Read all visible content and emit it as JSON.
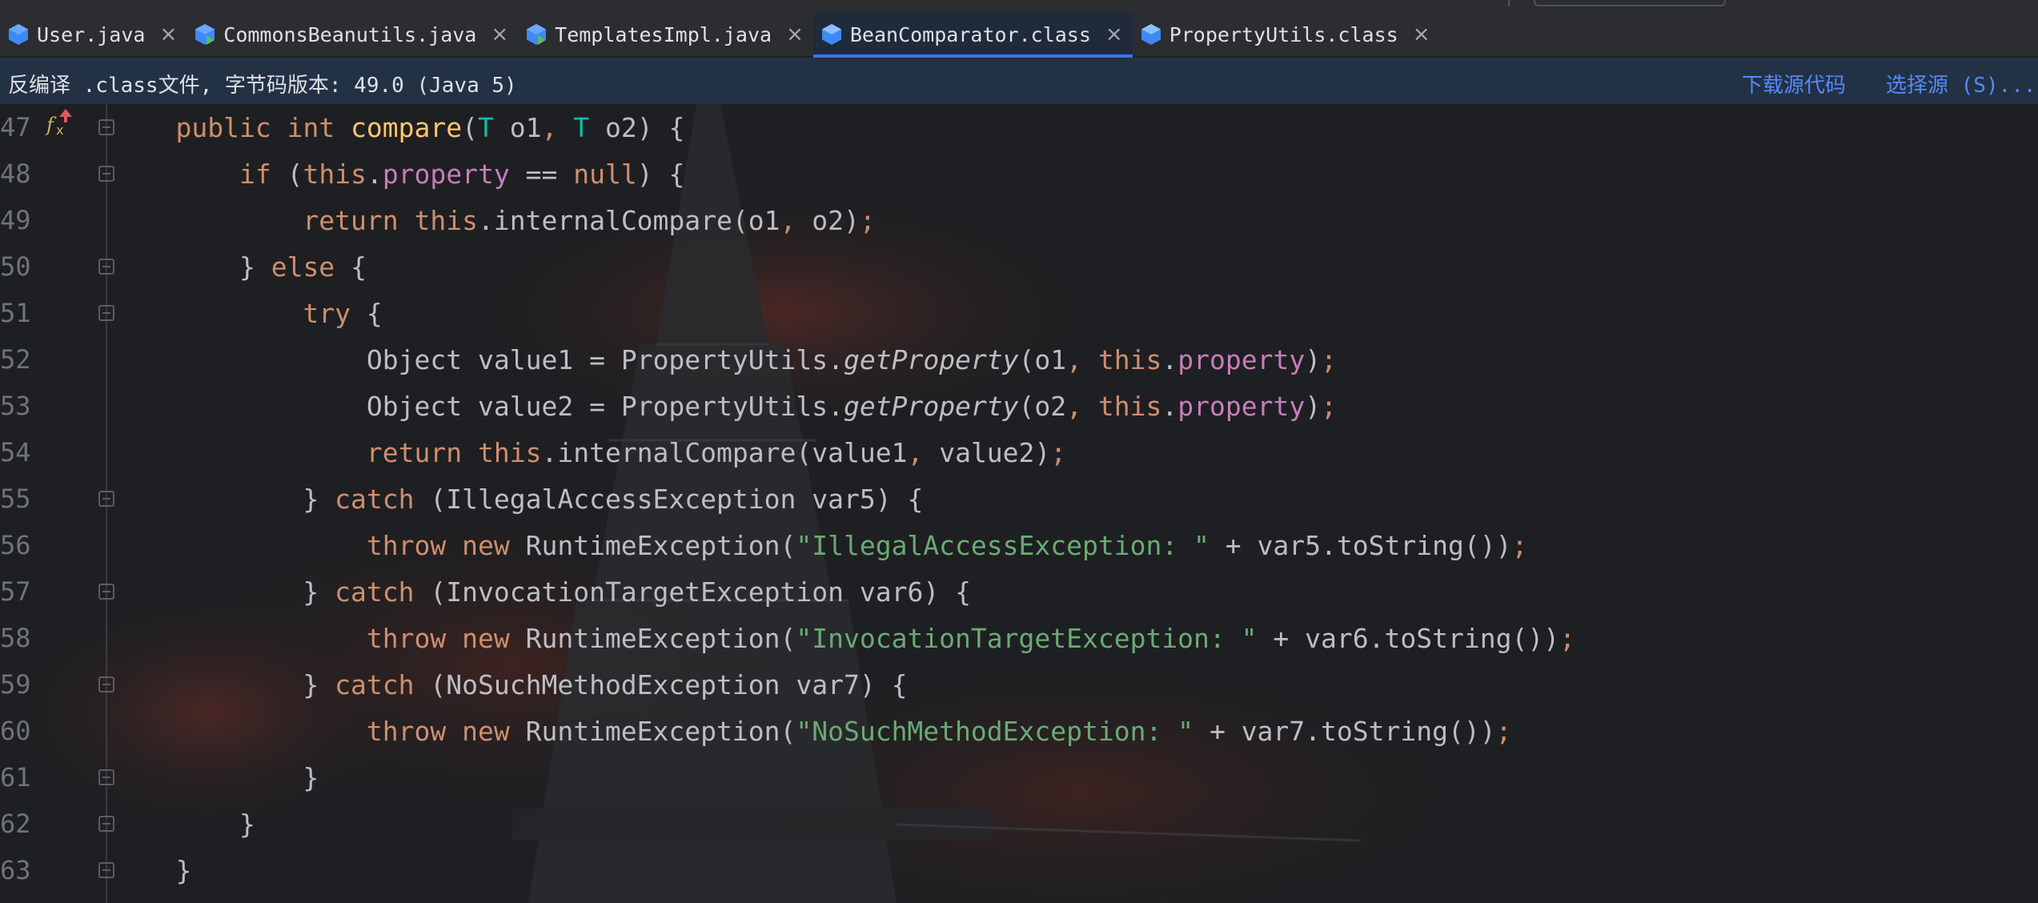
{
  "tabs": [
    {
      "label": "User.java",
      "icon": "java-class-icon",
      "active": false
    },
    {
      "label": "CommonsBeanutils.java",
      "icon": "java-class-run-icon",
      "active": false
    },
    {
      "label": "TemplatesImpl.java",
      "icon": "java-class-run-icon",
      "active": false
    },
    {
      "label": "BeanComparator.class",
      "icon": "class-file-icon",
      "active": true
    },
    {
      "label": "PropertyUtils.class",
      "icon": "class-file-icon",
      "active": false
    }
  ],
  "tab_close_glyph": "×",
  "notice": {
    "message": "反编译 .class文件, 字节码版本: 49.0 (Java 5)",
    "download_source": "下载源代码",
    "choose_source": "选择源 (S)..."
  },
  "editor": {
    "lines": [
      {
        "number": "47",
        "text": "    public int compare(T o1, T o2) {"
      },
      {
        "number": "48",
        "text": "        if (this.property == null) {"
      },
      {
        "number": "49",
        "text": "            return this.internalCompare(o1, o2);"
      },
      {
        "number": "50",
        "text": "        } else {"
      },
      {
        "number": "51",
        "text": "            try {"
      },
      {
        "number": "52",
        "text": "                Object value1 = PropertyUtils.getProperty(o1, this.property);"
      },
      {
        "number": "53",
        "text": "                Object value2 = PropertyUtils.getProperty(o2, this.property);"
      },
      {
        "number": "54",
        "text": "                return this.internalCompare(value1, value2);"
      },
      {
        "number": "55",
        "text": "            } catch (IllegalAccessException var5) {"
      },
      {
        "number": "56",
        "text": "                throw new RuntimeException(\"IllegalAccessException: \" + var5.toString());"
      },
      {
        "number": "57",
        "text": "            } catch (InvocationTargetException var6) {"
      },
      {
        "number": "58",
        "text": "                throw new RuntimeException(\"InvocationTargetException: \" + var6.toString());"
      },
      {
        "number": "59",
        "text": "            } catch (NoSuchMethodException var7) {"
      },
      {
        "number": "60",
        "text": "                throw new RuntimeException(\"NoSuchMethodException: \" + var7.toString());"
      },
      {
        "number": "61",
        "text": "            }"
      },
      {
        "number": "62",
        "text": "        }"
      },
      {
        "number": "63",
        "text": "    }"
      }
    ],
    "gutter_icon": "implementation-override-icon"
  },
  "colors": {
    "keyword": "#cf8e6d",
    "method_decl": "#ffc66d",
    "field": "#c77dbb",
    "string": "#6aab73",
    "type_param": "#16baac",
    "plain": "#bcbec4",
    "link": "#548af7",
    "accent": "#3574f0"
  }
}
